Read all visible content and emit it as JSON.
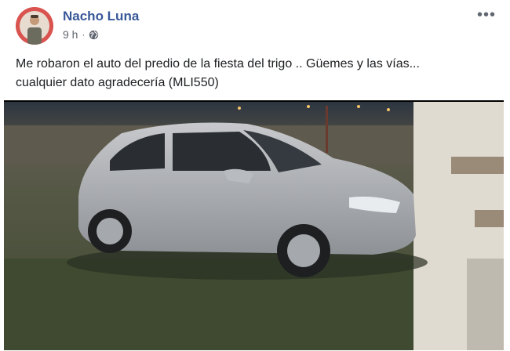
{
  "post": {
    "author": "Nacho Luna",
    "time": "9 h",
    "privacy_icon": "globe-icon",
    "more_icon": "more-options-icon",
    "text_line1": "Me robaron el auto del predio de la fiesta del trigo .. Güemes y las vías...",
    "text_line2": "cualquier dato agradecería (MLI550)"
  }
}
